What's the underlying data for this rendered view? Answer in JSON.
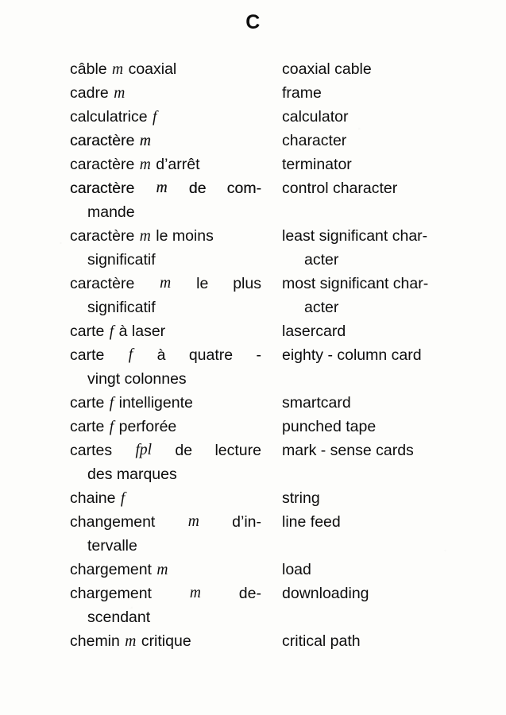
{
  "page": {
    "header_letter": "C",
    "language_pair": "French – English"
  },
  "entries": [
    {
      "fr_lines": [
        {
          "text": "câble",
          "marker": "m",
          "tail": "coaxial",
          "style": "normal",
          "indent": false
        }
      ],
      "en_lines": [
        {
          "text": "coaxial cable",
          "style": "normal",
          "indent": false
        }
      ]
    },
    {
      "fr_lines": [
        {
          "text": "cadre",
          "marker": "m",
          "tail": "",
          "style": "normal",
          "indent": false
        }
      ],
      "en_lines": [
        {
          "text": "frame",
          "style": "normal",
          "indent": false
        }
      ]
    },
    {
      "fr_lines": [
        {
          "text": "calculatrice",
          "marker": "f",
          "tail": "",
          "style": "normal",
          "indent": false
        }
      ],
      "en_lines": [
        {
          "text": "calculator",
          "style": "normal",
          "indent": false
        }
      ]
    },
    {
      "fr_lines": [
        {
          "text": "caractère",
          "marker": "m",
          "tail": "",
          "style": "inky",
          "indent": false
        }
      ],
      "en_lines": [
        {
          "text": "character",
          "style": "normal",
          "indent": false
        }
      ]
    },
    {
      "fr_lines": [
        {
          "text": "caractère",
          "marker": "m",
          "tail": "d’arrêt",
          "style": "normal",
          "indent": false
        }
      ],
      "en_lines": [
        {
          "text": "terminator",
          "style": "normal",
          "indent": false
        }
      ]
    },
    {
      "fr_lines": [
        {
          "text": "caractère",
          "marker": "m",
          "tail": "de com-",
          "style": "inky just",
          "indent": false
        },
        {
          "text": "mande",
          "marker": "",
          "tail": "",
          "style": "normal",
          "indent": true
        }
      ],
      "en_lines": [
        {
          "text": "control character",
          "style": "normal",
          "indent": false
        }
      ]
    },
    {
      "fr_lines": [
        {
          "text": "caractère",
          "marker": "m",
          "tail": "le moins",
          "style": "normal",
          "indent": false
        },
        {
          "text": "significatif",
          "marker": "",
          "tail": "",
          "style": "normal",
          "indent": true
        }
      ],
      "en_lines": [
        {
          "text": "least significant char-",
          "style": "normal",
          "indent": false
        },
        {
          "text": "acter",
          "style": "normal",
          "indent": true
        }
      ]
    },
    {
      "fr_lines": [
        {
          "text": "caractère",
          "marker": "m",
          "tail": "le plus",
          "style": "just",
          "indent": false
        },
        {
          "text": "significatif",
          "marker": "",
          "tail": "",
          "style": "normal",
          "indent": true
        }
      ],
      "en_lines": [
        {
          "text": "most significant char-",
          "style": "normal",
          "indent": false
        },
        {
          "text": "acter",
          "style": "normal",
          "indent": true
        }
      ]
    },
    {
      "fr_lines": [
        {
          "text": "carte",
          "marker": "f",
          "tail": "à laser",
          "style": "normal",
          "indent": false
        }
      ],
      "en_lines": [
        {
          "text": "lasercard",
          "style": "normal",
          "indent": false
        }
      ]
    },
    {
      "fr_lines": [
        {
          "text": "carte",
          "marker": "f",
          "tail": "à quatre -",
          "style": "just",
          "indent": false
        },
        {
          "text": "vingt colonnes",
          "marker": "",
          "tail": "",
          "style": "normal",
          "indent": true
        }
      ],
      "en_lines": [
        {
          "text": "eighty - column card",
          "style": "normal",
          "indent": false
        }
      ]
    },
    {
      "fr_lines": [
        {
          "text": "carte",
          "marker": "f",
          "tail": "intelligente",
          "style": "normal",
          "indent": false
        }
      ],
      "en_lines": [
        {
          "text": "smartcard",
          "style": "normal",
          "indent": false
        }
      ]
    },
    {
      "fr_lines": [
        {
          "text": "carte",
          "marker": "f",
          "tail": "perforée",
          "style": "normal",
          "indent": false
        }
      ],
      "en_lines": [
        {
          "text": "punched tape",
          "style": "normal",
          "indent": false
        }
      ]
    },
    {
      "fr_lines": [
        {
          "text": "cartes",
          "marker": "fpl",
          "tail": "de lecture",
          "style": "just",
          "indent": false
        },
        {
          "text": "des marques",
          "marker": "",
          "tail": "",
          "style": "normal",
          "indent": true
        }
      ],
      "en_lines": [
        {
          "text": "mark - sense cards",
          "style": "normal",
          "indent": false
        }
      ]
    },
    {
      "fr_lines": [
        {
          "text": "chaine",
          "marker": "f",
          "tail": "",
          "style": "normal",
          "indent": false
        }
      ],
      "en_lines": [
        {
          "text": "string",
          "style": "normal",
          "indent": false
        }
      ]
    },
    {
      "fr_lines": [
        {
          "text": "changement",
          "marker": "m",
          "tail": "d’in-",
          "style": "just",
          "indent": false
        },
        {
          "text": "tervalle",
          "marker": "",
          "tail": "",
          "style": "normal",
          "indent": true
        }
      ],
      "en_lines": [
        {
          "text": "line feed",
          "style": "normal",
          "indent": false
        }
      ]
    },
    {
      "fr_lines": [
        {
          "text": "chargement",
          "marker": "m",
          "tail": "",
          "style": "normal",
          "indent": false
        }
      ],
      "en_lines": [
        {
          "text": "load",
          "style": "normal",
          "indent": false
        }
      ]
    },
    {
      "fr_lines": [
        {
          "text": "chargement",
          "marker": "m",
          "tail": "de-",
          "style": "just",
          "indent": false
        },
        {
          "text": "scendant",
          "marker": "",
          "tail": "",
          "style": "normal",
          "indent": true
        }
      ],
      "en_lines": [
        {
          "text": "downloading",
          "style": "normal",
          "indent": false
        }
      ]
    },
    {
      "fr_lines": [
        {
          "text": "chemin",
          "marker": "m",
          "tail": "critique",
          "style": "normal",
          "indent": false
        }
      ],
      "en_lines": [
        {
          "text": "critical path",
          "style": "normal",
          "indent": false
        }
      ]
    }
  ]
}
